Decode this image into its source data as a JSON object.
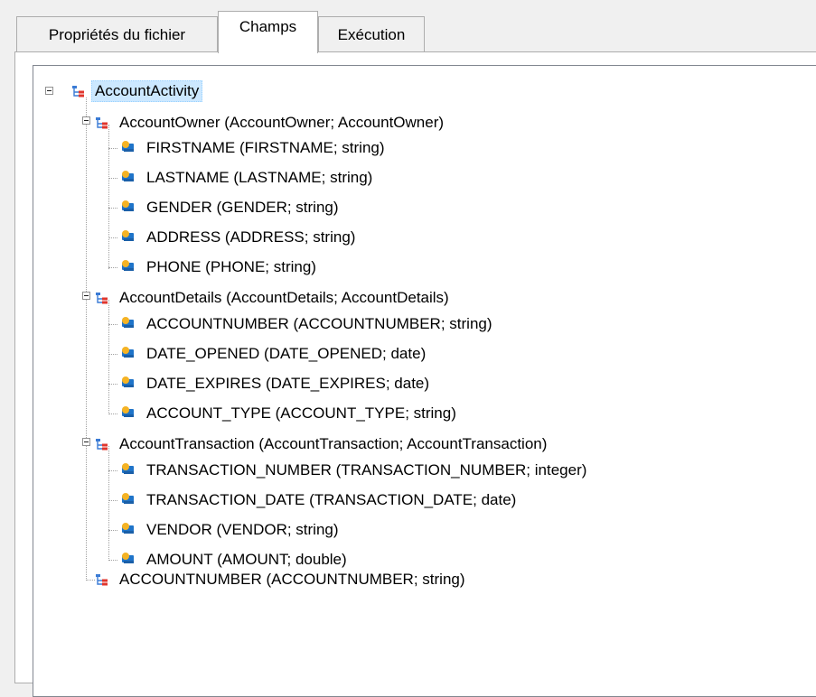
{
  "tabs": [
    {
      "label": "Propriétés du fichier",
      "active": false
    },
    {
      "label": "Champs",
      "active": true
    },
    {
      "label": "Exécution",
      "active": false
    }
  ],
  "tree": {
    "root": {
      "label": "AccountActivity",
      "icon": "structure-icon",
      "selected": true,
      "expanded": true
    },
    "groups": [
      {
        "label": "AccountOwner (AccountOwner; AccountOwner)",
        "icon": "structure-icon",
        "expanded": true,
        "fields": [
          {
            "label": "FIRSTNAME (FIRSTNAME; string)",
            "icon": "field-key-icon"
          },
          {
            "label": "LASTNAME (LASTNAME; string)",
            "icon": "field-key-icon"
          },
          {
            "label": "GENDER (GENDER; string)",
            "icon": "field-key-icon"
          },
          {
            "label": "ADDRESS (ADDRESS; string)",
            "icon": "field-key-icon"
          },
          {
            "label": "PHONE (PHONE; string)",
            "icon": "field-key-icon"
          }
        ]
      },
      {
        "label": "AccountDetails (AccountDetails; AccountDetails)",
        "icon": "structure-icon",
        "expanded": true,
        "fields": [
          {
            "label": "ACCOUNTNUMBER (ACCOUNTNUMBER; string)",
            "icon": "field-key-icon"
          },
          {
            "label": "DATE_OPENED (DATE_OPENED; date)",
            "icon": "field-key-icon"
          },
          {
            "label": "DATE_EXPIRES (DATE_EXPIRES; date)",
            "icon": "field-key-icon"
          },
          {
            "label": "ACCOUNT_TYPE (ACCOUNT_TYPE; string)",
            "icon": "field-key-icon"
          }
        ]
      },
      {
        "label": "AccountTransaction (AccountTransaction; AccountTransaction)",
        "icon": "structure-icon",
        "expanded": true,
        "fields": [
          {
            "label": "TRANSACTION_NUMBER (TRANSACTION_NUMBER; integer)",
            "icon": "field-key-icon"
          },
          {
            "label": "TRANSACTION_DATE (TRANSACTION_DATE; date)",
            "icon": "field-key-icon"
          },
          {
            "label": "VENDOR (VENDOR; string)",
            "icon": "field-key-icon"
          },
          {
            "label": "AMOUNT (AMOUNT; double)",
            "icon": "field-key-icon"
          }
        ]
      }
    ],
    "trailing_item": {
      "label": "ACCOUNTNUMBER (ACCOUNTNUMBER; string)",
      "icon": "structure-icon"
    }
  },
  "colors": {
    "selection_background": "#cce8ff",
    "structure_icon": "#e0362d",
    "structure_icon_secondary": "#3a7bd5",
    "field_icon_primary": "#1f74c9",
    "field_icon_secondary": "#f5b324"
  }
}
